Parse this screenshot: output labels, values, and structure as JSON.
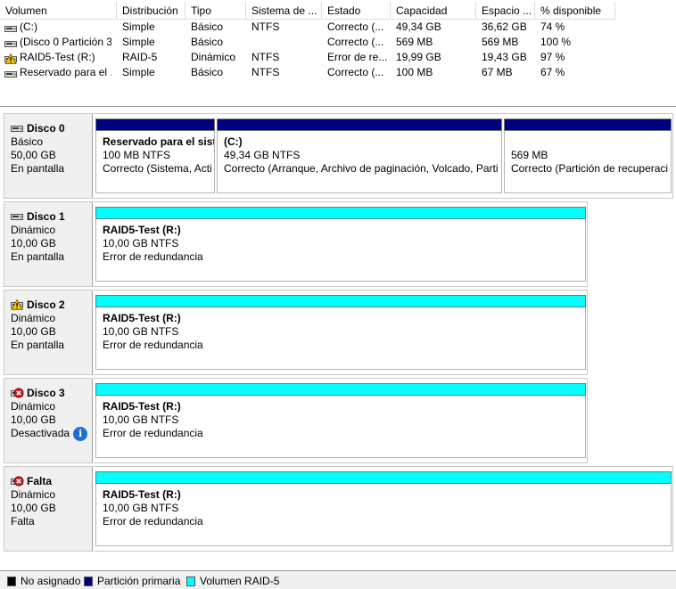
{
  "volume_list": {
    "columns": [
      "Volumen",
      "Distribución",
      "Tipo",
      "Sistema de ...",
      "Estado",
      "Capacidad",
      "Espacio ...",
      "% disponible"
    ],
    "rows": [
      {
        "icon": "disk-volume-icon",
        "volume": "(C:)",
        "layout": "Simple",
        "type": "Básico",
        "fs": "NTFS",
        "status": "Correcto (...",
        "capacity": "49,34 GB",
        "free": "36,62 GB",
        "pct": "74 %"
      },
      {
        "icon": "disk-volume-icon",
        "volume": "(Disco 0 Partición 3)",
        "layout": "Simple",
        "type": "Básico",
        "fs": "",
        "status": "Correcto (...",
        "capacity": "569 MB",
        "free": "569 MB",
        "pct": "100 %"
      },
      {
        "icon": "warning-volume-icon",
        "volume": "RAID5-Test (R:)",
        "layout": "RAID-5",
        "type": "Dinámico",
        "fs": "NTFS",
        "status": "Error de re...",
        "capacity": "19,99 GB",
        "free": "19,43 GB",
        "pct": "97 %"
      },
      {
        "icon": "disk-volume-icon",
        "volume": "Reservado para el ...",
        "layout": "Simple",
        "type": "Básico",
        "fs": "NTFS",
        "status": "Correcto (...",
        "capacity": "100 MB",
        "free": "67 MB",
        "pct": "67 %"
      }
    ]
  },
  "disks": [
    {
      "name": "Disco 0",
      "icon": "disk-icon",
      "type": "Básico",
      "size": "50,00 GB",
      "state": "En pantalla",
      "partitions": [
        {
          "bar": "primary",
          "title": "Reservado para el sist",
          "line2": "100 MB NTFS",
          "line3": "Correcto (Sistema, Acti"
        },
        {
          "bar": "primary",
          "title": "(C:)",
          "line2": "49,34 GB NTFS",
          "line3": "Correcto (Arranque, Archivo de paginación, Volcado, Parti"
        },
        {
          "bar": "primary",
          "title": "",
          "line2": "569 MB",
          "line3": "Correcto (Partición de recuperaci"
        }
      ]
    },
    {
      "name": "Disco 1",
      "icon": "disk-icon",
      "type": "Dinámico",
      "size": "10,00 GB",
      "state": "En pantalla",
      "partitions": [
        {
          "bar": "raid",
          "title": "RAID5-Test  (R:)",
          "line2": "10,00 GB NTFS",
          "line3": "Error de redundancia"
        }
      ]
    },
    {
      "name": "Disco 2",
      "icon": "warning-disk-icon",
      "type": "Dinámico",
      "size": "10,00 GB",
      "state": "En pantalla",
      "partitions": [
        {
          "bar": "raid",
          "title": "RAID5-Test  (R:)",
          "line2": "10,00 GB NTFS",
          "line3": "Error de redundancia"
        }
      ]
    },
    {
      "name": "Disco 3",
      "icon": "error-disk-icon",
      "type": "Dinámico",
      "size": "10,00 GB",
      "state": "Desactivada",
      "partitions": [
        {
          "bar": "raid",
          "title": "RAID5-Test  (R:)",
          "line2": "10,00 GB NTFS",
          "line3": "Error de redundancia"
        }
      ]
    },
    {
      "name": "Falta",
      "icon": "missing-disk-icon",
      "type": "Dinámico",
      "size": "10,00 GB",
      "state": "Falta",
      "partitions": [
        {
          "bar": "raid",
          "title": "RAID5-Test  (R:)",
          "line2": "10,00 GB NTFS",
          "line3": "Error de redundancia"
        }
      ]
    }
  ],
  "legend": [
    {
      "label": "No asignado",
      "color": "#000000"
    },
    {
      "label": "Partición primaria",
      "color": "#000080"
    },
    {
      "label": "Volumen RAID-5",
      "color": "#00ffff"
    }
  ],
  "info_icon": "i"
}
